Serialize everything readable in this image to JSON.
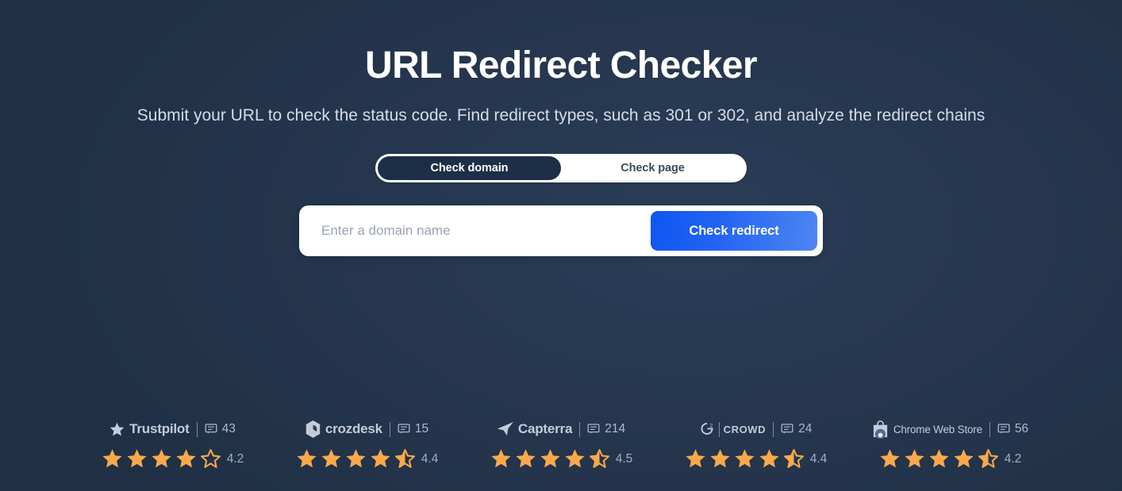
{
  "hero": {
    "title": "URL Redirect Checker",
    "subtitle": "Submit your URL to check the status code. Find redirect types, such as 301 or 302, and analyze the redirect chains"
  },
  "toggle": {
    "options": [
      {
        "label": "Check domain",
        "active": true
      },
      {
        "label": "Check page",
        "active": false
      }
    ]
  },
  "search": {
    "placeholder": "Enter a domain name",
    "value": "",
    "button_label": "Check redirect"
  },
  "ratings": [
    {
      "brand": "Trustpilot",
      "icon": "trustpilot-star-icon",
      "review_count": "43",
      "rating": "4.2",
      "stars_full": 4,
      "stars_half": 0,
      "stars_empty": 1
    },
    {
      "brand": "crozdesk",
      "icon": "crozdesk-hexagon-icon",
      "review_count": "15",
      "rating": "4.4",
      "stars_full": 4,
      "stars_half": 1,
      "stars_empty": 0
    },
    {
      "brand": "Capterra",
      "icon": "capterra-arrow-icon",
      "review_count": "214",
      "rating": "4.5",
      "stars_full": 4,
      "stars_half": 1,
      "stars_empty": 0
    },
    {
      "brand": "CROWD",
      "icon": "g2-crowd-icon",
      "review_count": "24",
      "rating": "4.4",
      "stars_full": 4,
      "stars_half": 1,
      "stars_empty": 0
    },
    {
      "brand": "Chrome Web Store",
      "icon": "chrome-web-store-bag-icon",
      "review_count": "56",
      "rating": "4.2",
      "stars_full": 4,
      "stars_half": 1,
      "stars_empty": 0
    }
  ],
  "colors": {
    "background": "#25364e",
    "accent_blue": "#1257f5",
    "accent_blue_light": "#4f86f2",
    "star": "#f9a94a",
    "toggle_active": "#1d2e47",
    "text_muted": "#adbacb"
  }
}
